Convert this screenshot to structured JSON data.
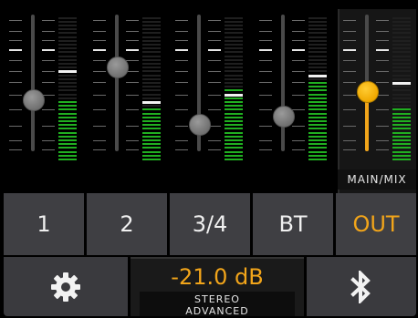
{
  "strips": [
    {
      "fader_level_pct": 38,
      "meter_pct": 42,
      "peak_pct": 60
    },
    {
      "fader_level_pct": 62,
      "meter_pct": 36,
      "peak_pct": 40
    },
    {
      "fader_level_pct": 20,
      "meter_pct": 50,
      "peak_pct": 45
    },
    {
      "fader_level_pct": 26,
      "meter_pct": 56,
      "peak_pct": 58
    }
  ],
  "main_mix": {
    "label": "MAIN/MIX",
    "fader_level_pct": 44,
    "meter_pct": 38,
    "peak_pct": 52
  },
  "tabs": [
    {
      "label": "1",
      "active": false
    },
    {
      "label": "2",
      "active": false
    },
    {
      "label": "3/4",
      "active": false
    },
    {
      "label": "BT",
      "active": false
    },
    {
      "label": "OUT",
      "active": true
    }
  ],
  "bottom": {
    "settings_icon": "gear-icon",
    "level": "-21.0 dB",
    "mode_line1": "STEREO",
    "mode_line2": "ADVANCED",
    "bluetooth_icon": "bluetooth-icon"
  },
  "colors": {
    "accent": "#f2a51a",
    "meter_green": "#20b020",
    "tab_bg": "#3f3f43"
  }
}
